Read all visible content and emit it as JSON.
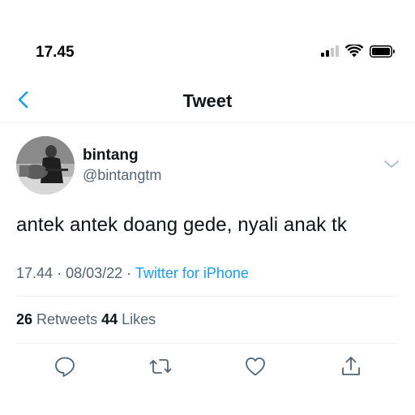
{
  "status_bar": {
    "time": "17.45",
    "icons": [
      "cellular-signal-icon",
      "wifi-icon",
      "battery-icon"
    ]
  },
  "nav": {
    "back_icon": "chevron-left-icon",
    "title": "Tweet"
  },
  "tweet": {
    "author": {
      "name": "bintang",
      "handle": "@bintangtm"
    },
    "menu_icon": "chevron-down-icon",
    "text": "antek antek doang gede, nyali anak tk",
    "time": "17.44",
    "date": "08/03/22",
    "source": "Twitter for iPhone",
    "retweets_count": "26",
    "retweets_label": "Retweets",
    "likes_count": "44",
    "likes_label": "Likes"
  },
  "actions": [
    "reply-icon",
    "retweet-icon",
    "like-icon",
    "share-icon"
  ],
  "colors": {
    "accent": "#1d9bf0",
    "text_primary": "#0f1419",
    "text_secondary": "#536471",
    "divider": "#eff3f4"
  }
}
